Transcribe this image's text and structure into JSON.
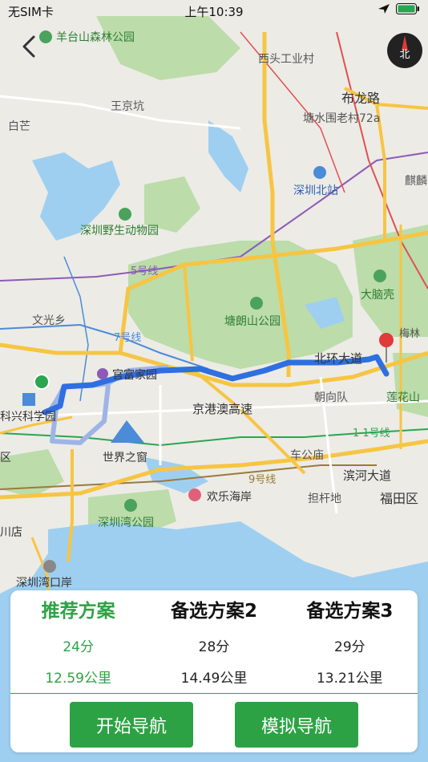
{
  "status_bar": {
    "carrier": "无SIM卡",
    "time": "上午10:39"
  },
  "compass": {
    "label": "北"
  },
  "map": {
    "labels": {
      "yangtaishan": "羊台山森林公园",
      "xitou": "西头工业村",
      "wangjingkeng": "王京坑",
      "bulong": "布龙路",
      "baimang": "白芒",
      "tangshui": "塘水围老村72a",
      "shenzhen_north": "深圳北站",
      "qilin": "麒麟",
      "zoo": "深圳野生动物园",
      "line5": "5号线",
      "danaoke": "大脑壳",
      "wenguangxiang": "文光乡",
      "tanglang": "塘朗山公园",
      "meilin": "梅林",
      "line7": "7号线",
      "beihuan": "北环大道",
      "guanfu": "官富家园",
      "lianhuashan": "莲花山",
      "kexing": "科兴科学园",
      "chaoyang": "朝向队",
      "jinggang": "京港澳高速",
      "line11": "1 1号线",
      "window": "世界之窗",
      "chegongmiao": "车公庙",
      "binhe": "滨河大道",
      "line9": "9号线",
      "happycoast": "欢乐海岸",
      "zhuagan": "担杆地",
      "futian": "福田区",
      "bay_park": "深圳湾公园",
      "chuan_dian": "川店",
      "bay_port": "深圳湾口岸",
      "qu": "区",
      "shi": "山"
    }
  },
  "panel": {
    "plans": [
      {
        "name": "推荐方案",
        "duration": "24分",
        "distance": "12.59公里"
      },
      {
        "name": "备选方案2",
        "duration": "28分",
        "distance": "14.49公里"
      },
      {
        "name": "备选方案3",
        "duration": "29分",
        "distance": "13.21公里"
      }
    ],
    "start_nav": "开始导航",
    "simulate_nav": "模拟导航"
  },
  "colors": {
    "accent": "#2da244",
    "route": "#2f6fe0",
    "park": "#bcdcaa",
    "water": "#9ecff0",
    "road_major": "#f6c542"
  }
}
